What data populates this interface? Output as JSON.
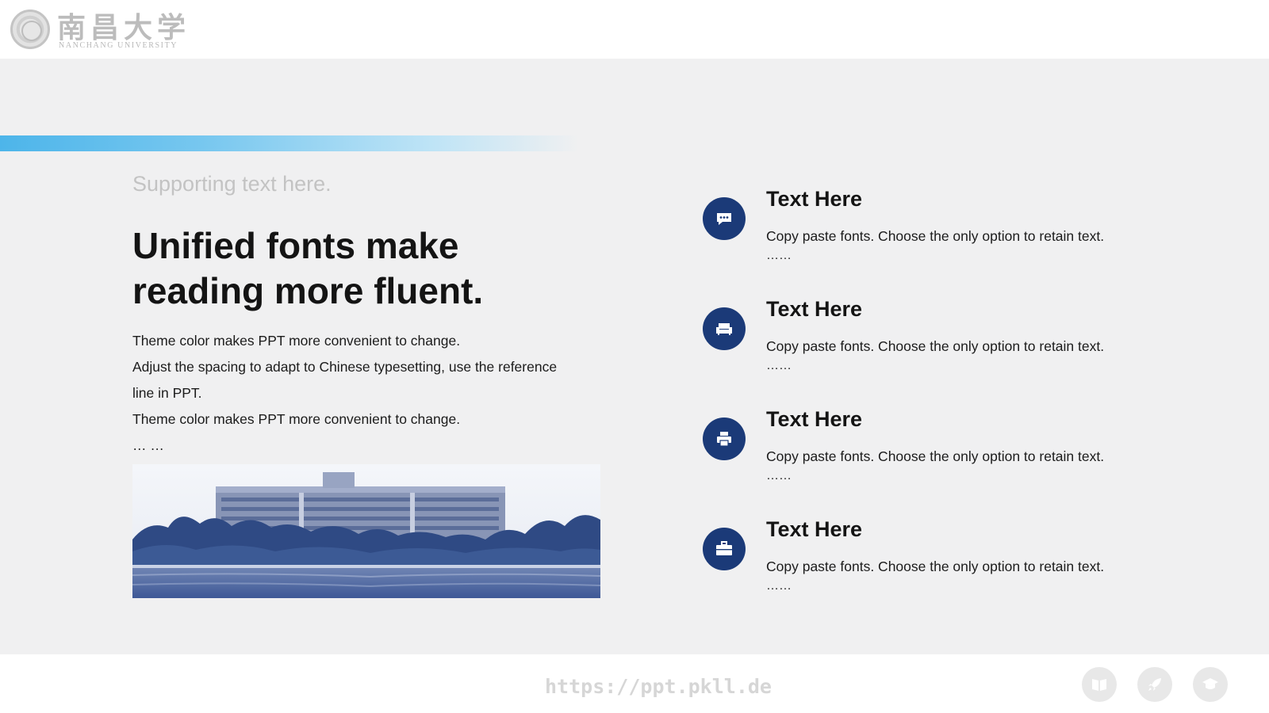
{
  "header": {
    "logo_cn": "南昌大学",
    "logo_en": "NANCHANG UNIVERSITY"
  },
  "left": {
    "supporting": "Supporting text here.",
    "headline_line1": "Unified fonts make",
    "headline_line2": "reading more fluent.",
    "body_lines": [
      "Theme color makes PPT more convenient to change.",
      "Adjust the spacing to adapt to Chinese typesetting, use the reference",
      "line in PPT.",
      "Theme color makes PPT more convenient to change.",
      "… …"
    ]
  },
  "items": [
    {
      "icon": "chat-bubble-icon",
      "title": "Text Here",
      "desc": "Copy paste fonts. Choose the only option to retain text.",
      "dots": "……"
    },
    {
      "icon": "sofa-icon",
      "title": "Text Here",
      "desc": "Copy paste fonts. Choose the only option to retain text.",
      "dots": "……"
    },
    {
      "icon": "printer-icon",
      "title": "Text Here",
      "desc": "Copy paste fonts. Choose the only option to retain text.",
      "dots": "……"
    },
    {
      "icon": "briefcase-icon",
      "title": "Text Here",
      "desc": "Copy paste fonts. Choose the only option to retain text.",
      "dots": "……"
    }
  ],
  "footer": {
    "url": "https://ppt.pkll.de",
    "icons": [
      "book-icon",
      "rocket-icon",
      "graduation-cap-icon"
    ]
  },
  "colors": {
    "accent_blue": "#4db5ea",
    "icon_navy": "#1b3a78",
    "background": "#f0f0f1"
  }
}
